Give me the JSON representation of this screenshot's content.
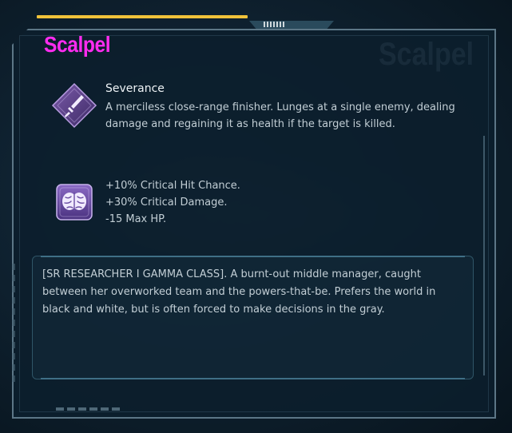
{
  "card": {
    "title": "Scalpel",
    "watermark": "Scalpel",
    "title_color": "#ff2cf0"
  },
  "ability": {
    "icon": "dagger-icon",
    "name": "Severance",
    "description": "A merciless close-range finisher. Lunges at a single enemy, dealing damage and regaining it as health if the target is killed."
  },
  "trait": {
    "icon": "brain-icon",
    "stats": [
      "+10% Critical Hit Chance.",
      "+30% Critical Damage.",
      "-15 Max HP."
    ]
  },
  "bio": {
    "text": "[SR RESEARCHER I GAMMA CLASS]. A burnt-out middle manager, caught between her overworked team and the powers-that-be. Prefers the world in black and white, but is often forced to make decisions in the gray."
  }
}
